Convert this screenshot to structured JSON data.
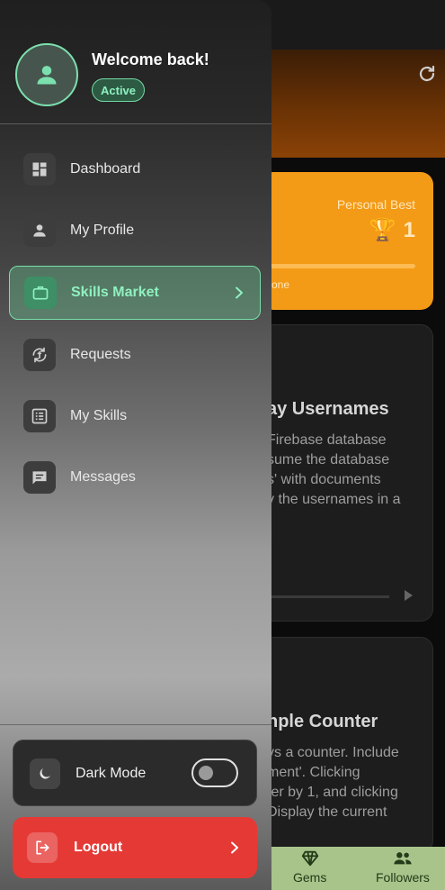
{
  "background": {
    "personal_best": {
      "label": "Personal Best",
      "trophy": "🏆",
      "value": "1",
      "progress_suffix": "one"
    },
    "cards": [
      {
        "title": "ay Usernames",
        "text": "Firebase database\nsume the database\ns' with documents\ny the usernames in a"
      },
      {
        "title": "nple Counter",
        "text": "ys a counter. Include\nment'. Clicking\nter by 1, and clicking\nDisplay the current"
      }
    ],
    "bottom_nav": [
      {
        "label": "Gems",
        "icon": "gem-icon"
      },
      {
        "label": "Followers",
        "icon": "people-icon"
      }
    ]
  },
  "drawer": {
    "header": {
      "welcome": "Welcome back!",
      "status": "Active",
      "avatar_icon": "person-icon"
    },
    "nav": [
      {
        "label": "Dashboard",
        "icon": "dashboard-icon",
        "active": false
      },
      {
        "label": "My Profile",
        "icon": "person-icon",
        "active": false
      },
      {
        "label": "Skills Market",
        "icon": "briefcase-icon",
        "active": true
      },
      {
        "label": "Requests",
        "icon": "swap-icon",
        "active": false
      },
      {
        "label": "My Skills",
        "icon": "list-icon",
        "active": false
      },
      {
        "label": "Messages",
        "icon": "chat-icon",
        "active": false
      }
    ],
    "dark_mode": {
      "label": "Dark Mode",
      "enabled": false
    },
    "logout": {
      "label": "Logout"
    }
  },
  "colors": {
    "accent": "#78dfa8",
    "logout": "#e53935",
    "personal_best_card": "#f39a16"
  }
}
